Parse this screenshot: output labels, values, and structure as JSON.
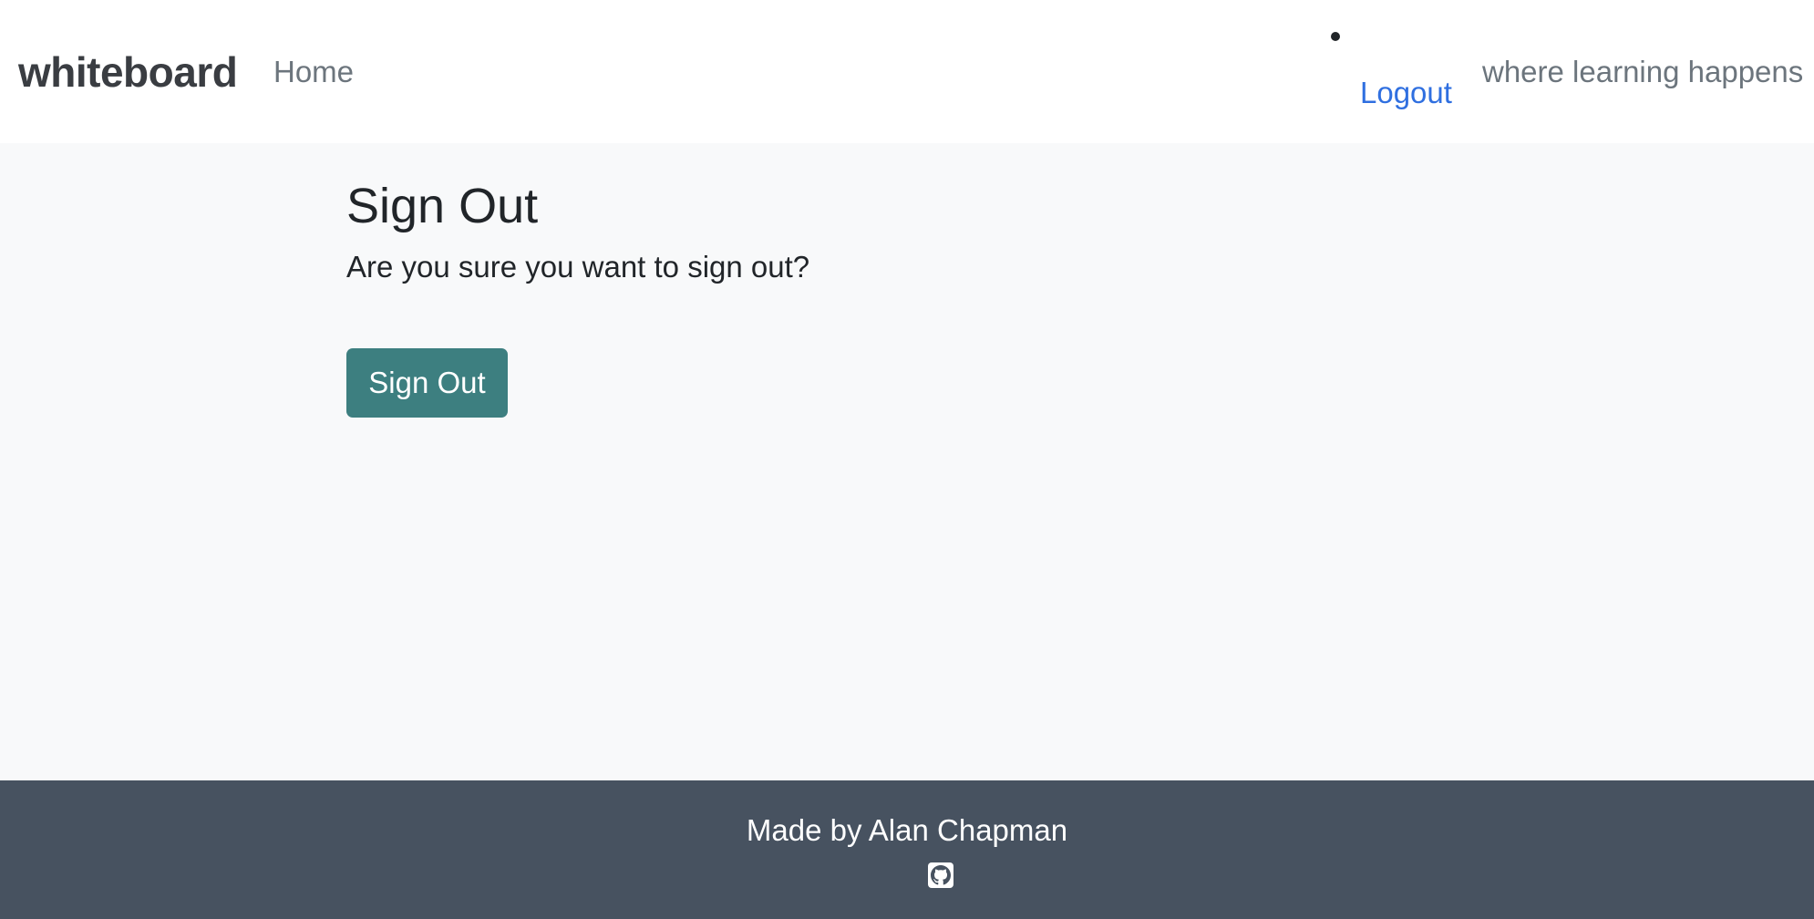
{
  "navbar": {
    "brand": "whiteboard",
    "home_label": "Home",
    "logout_label": "Logout",
    "tagline": "where learning happens"
  },
  "main": {
    "title": "Sign Out",
    "prompt": "Are you sure you want to sign out?",
    "signout_button_label": "Sign Out"
  },
  "footer": {
    "credit": "Made by Alan Chapman",
    "icon": "github-icon"
  },
  "colors": {
    "accent_button": "#3d7f80",
    "link_blue": "#2f6fe0",
    "footer_bg": "#475260",
    "page_bg": "#f8f9fa"
  }
}
